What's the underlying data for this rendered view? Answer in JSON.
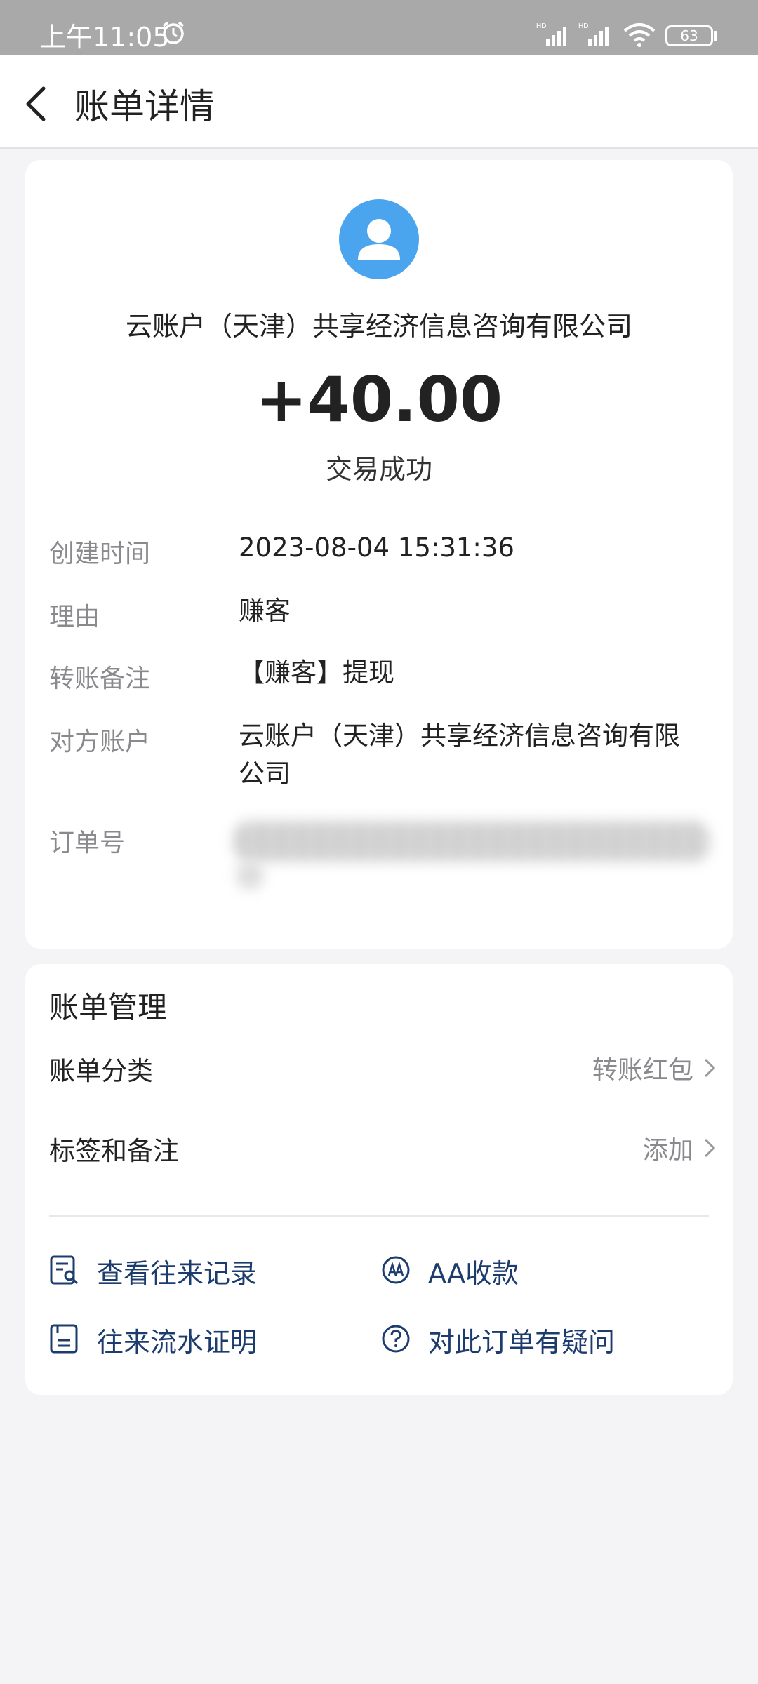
{
  "status_bar": {
    "time": "上午11:05",
    "battery": "63"
  },
  "nav": {
    "title": "账单详情"
  },
  "transaction": {
    "payee": "云账户（天津）共享经济信息咨询有限公司",
    "amount": "+40.00",
    "status": "交易成功"
  },
  "details": {
    "created_label": "创建时间",
    "created_value": "2023-08-04 15:31:36",
    "reason_label": "理由",
    "reason_value": "赚客",
    "note_label": "转账备注",
    "note_value": "【赚客】提现",
    "counterparty_label": "对方账户",
    "counterparty_value": "云账户（天津）共享经济信息咨询有限公司",
    "order_label": "订单号"
  },
  "manage": {
    "title": "账单管理",
    "category_label": "账单分类",
    "category_value": "转账红包",
    "tags_label": "标签和备注",
    "tags_value": "添加",
    "actions": [
      {
        "label": "查看往来记录",
        "icon": "record-search-icon"
      },
      {
        "label": "AA收款",
        "icon": "aa-icon"
      },
      {
        "label": "往来流水证明",
        "icon": "statement-icon"
      },
      {
        "label": "对此订单有疑问",
        "icon": "question-icon"
      }
    ]
  },
  "colors": {
    "accent": "#4aa4ee",
    "action_text": "#1d3c6e",
    "muted": "#8a8a8e"
  }
}
